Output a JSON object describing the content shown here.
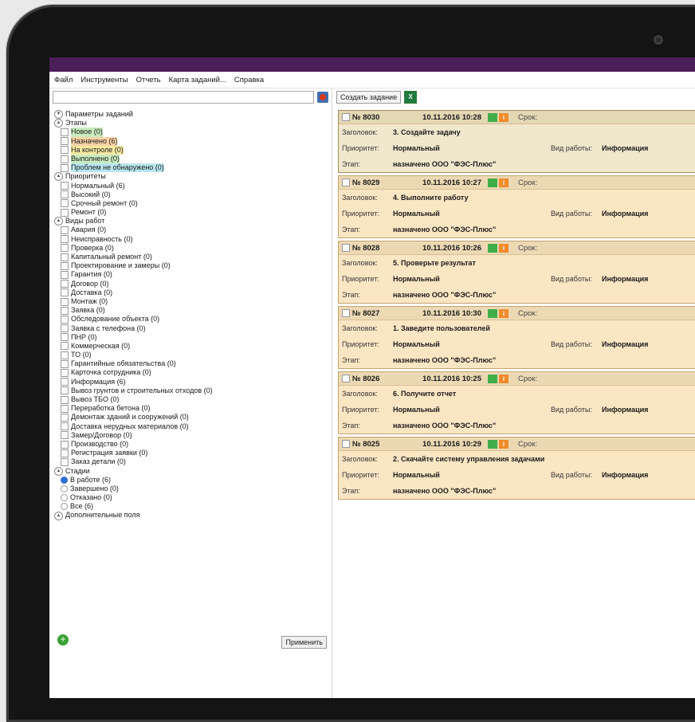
{
  "menu": [
    "Файл",
    "Инструменты",
    "Отчеть",
    "Карта заданий...",
    "Справка"
  ],
  "filters": {
    "params_title": "Параметры заданий",
    "stages_title": "Этапы",
    "stages": [
      {
        "label": "Новое (0)",
        "hl": "green"
      },
      {
        "label": "Назначено (6)",
        "hl": "orange"
      },
      {
        "label": "На контроле (0)",
        "hl": "yellow"
      },
      {
        "label": "Выполнено (0)",
        "hl": "green"
      },
      {
        "label": "Проблем не обнаружено (0)",
        "hl": "blue"
      }
    ],
    "priorities_title": "Приоритеты",
    "priorities": [
      "Нормальный (6)",
      "Высокий (0)",
      "Срочный ремонт (0)",
      "Ремонт (0)"
    ],
    "worktypes_title": "Виды работ",
    "worktypes": [
      "Авария (0)",
      "Неисправность (0)",
      "Проверка (0)",
      "Капитальный ремонт (0)",
      "Проектирование и замеры (0)",
      "Гарантия (0)",
      "Договор (0)",
      "Доставка (0)",
      "Монтаж (0)",
      "Заявка (0)",
      "Обследование объекта (0)",
      "Заявка с телефона (0)",
      "ПНР (0)",
      "Коммерческая (0)",
      "ТО (0)",
      "Гарантийные обязательства (0)",
      "Карточка сотрудника (0)",
      "Информация (6)",
      "Вывоз грунтов и строительных отходов (0)",
      "Вывоз ТБО (0)",
      "Переработка бетона (0)",
      "Демонтаж зданий и сооружений (0)",
      "Доставка нерудных материалов (0)",
      "Замер/Договор (0)",
      "Производство (0)",
      "Регистрация заявки (0)",
      "Заказ детали (0)"
    ],
    "statuses_title": "Стадии",
    "statuses": [
      {
        "label": "В работе (6)",
        "selected": true
      },
      {
        "label": "Завершено (0)",
        "selected": false
      },
      {
        "label": "Отказано (0)",
        "selected": false
      },
      {
        "label": "Все (6)",
        "selected": false
      }
    ],
    "extra_title": "Дополнительные поля",
    "apply_label": "Применить"
  },
  "toolbar": {
    "create_label": "Создать задание",
    "export_icon_text": "X"
  },
  "labels": {
    "title": "Заголовок:",
    "priority": "Приоритет:",
    "stage": "Этап:",
    "work_type": "Вид работы:",
    "due": "Срок:"
  },
  "tasks": [
    {
      "number": "№ 8030",
      "date": "10.11.2016 10:28",
      "title": "3. Создайте задачу",
      "priority": "Нормальный",
      "work_type": "Информация",
      "stage": "назначено ООО \"ФЭС-Плюс\"",
      "selected": true
    },
    {
      "number": "№ 8029",
      "date": "10.11.2016 10:27",
      "title": "4. Выполните работу",
      "priority": "Нормальный",
      "work_type": "Информация",
      "stage": "назначено ООО \"ФЭС-Плюс\"",
      "selected": false
    },
    {
      "number": "№ 8028",
      "date": "10.11.2016 10:26",
      "title": "5. Проверьте результат",
      "priority": "Нормальный",
      "work_type": "Информация",
      "stage": "назначено ООО \"ФЭС-Плюс\"",
      "selected": false
    },
    {
      "number": "№ 8027",
      "date": "10.11.2016 10:30",
      "title": "1. Заведите пользователей",
      "priority": "Нормальный",
      "work_type": "Информация",
      "stage": "назначено ООО \"ФЭС-Плюс\"",
      "selected": false
    },
    {
      "number": "№ 8026",
      "date": "10.11.2016 10:25",
      "title": "6. Получите отчет",
      "priority": "Нормальный",
      "work_type": "Информация",
      "stage": "назначено ООО \"ФЭС-Плюс\"",
      "selected": false
    },
    {
      "number": "№ 8025",
      "date": "10.11.2016 10:29",
      "title": "2. Скачайте систему управления задачами",
      "priority": "Нормальный",
      "work_type": "Информация",
      "stage": "назначено ООО \"ФЭС-Плюс\"",
      "selected": false
    }
  ],
  "colors": {
    "titlebar": "#4b1f58",
    "task_bg": "#fbe6c4",
    "selected_bg": "#f1e7cd"
  }
}
